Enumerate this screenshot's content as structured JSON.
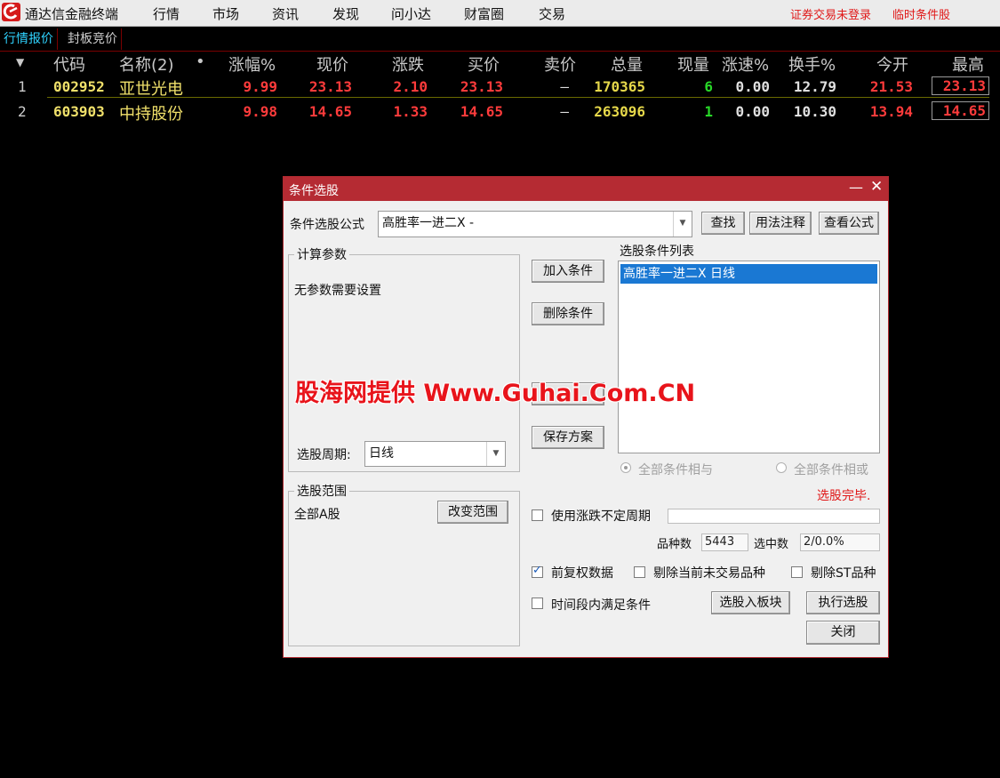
{
  "app": {
    "title": "通达信金融终端"
  },
  "menu": {
    "items": [
      "行情",
      "市场",
      "资讯",
      "发现",
      "问小达",
      "财富圈",
      "交易"
    ],
    "login_status": "证券交易未登录",
    "temp_pick": "临时条件股"
  },
  "tabs": [
    "行情报价",
    "封板竞价"
  ],
  "table": {
    "sort_marker": "▼",
    "headers": [
      "代码",
      "名称(2)",
      "•",
      "涨幅%",
      "现价",
      "涨跌",
      "买价",
      "卖价",
      "总量",
      "现量",
      "涨速%",
      "换手%",
      "今开",
      "最高"
    ],
    "rows": [
      {
        "index": "1",
        "code": "002952",
        "name": "亚世光电",
        "pct": "9.99",
        "price": "23.13",
        "chg": "2.10",
        "bid": "23.13",
        "ask": "–",
        "volume": "170365",
        "cur_vol": "6",
        "speed": "0.00",
        "turnover": "12.79",
        "open": "21.53",
        "high": "23.13"
      },
      {
        "index": "2",
        "code": "603903",
        "name": "中持股份",
        "pct": "9.98",
        "price": "14.65",
        "chg": "1.33",
        "bid": "14.65",
        "ask": "–",
        "volume": "263096",
        "cur_vol": "1",
        "speed": "0.00",
        "turnover": "10.30",
        "open": "13.94",
        "high": "14.65"
      }
    ]
  },
  "dialog": {
    "title": "条件选股",
    "minimize": "—",
    "close": "✕",
    "formula_label": "条件选股公式",
    "formula_value": "高胜率一进二X  -",
    "find_button": "查找",
    "usage_button": "用法注释",
    "view_formula_button": "查看公式",
    "params_group": "计算参数",
    "params_text": "无参数需要设置",
    "period_label": "选股周期:",
    "period_value": "日线",
    "add_condition": "加入条件",
    "delete_condition": "删除条件",
    "save_plan": "保存方案",
    "list_label": "选股条件列表",
    "list_items": [
      "高胜率一进二X  日线"
    ],
    "radio_and": "全部条件相与",
    "radio_or": "全部条件相或",
    "status": "选股完毕.",
    "range_group": "选股范围",
    "range_value": "全部A股",
    "change_range": "改变范围",
    "use_uncertain_period": "使用涨跌不定周期",
    "count_label": "品种数",
    "count_value": "5443",
    "selected_label": "选中数",
    "selected_value": "2/0.0%",
    "adj_data": "前复权数据",
    "exclude_nontrading": "剔除当前未交易品种",
    "exclude_st": "剔除ST品种",
    "period_satisfy": "时间段内满足条件",
    "to_block": "选股入板块",
    "execute": "执行选股",
    "close_button": "关闭"
  },
  "watermark": "股海网提供 Www.Guhai.Com.CN",
  "colors": {
    "red": "#ff3b3b",
    "yellow": "#e6d84a",
    "green": "#28d828",
    "white": "#e0e0e0",
    "accent": "#b52b33"
  }
}
